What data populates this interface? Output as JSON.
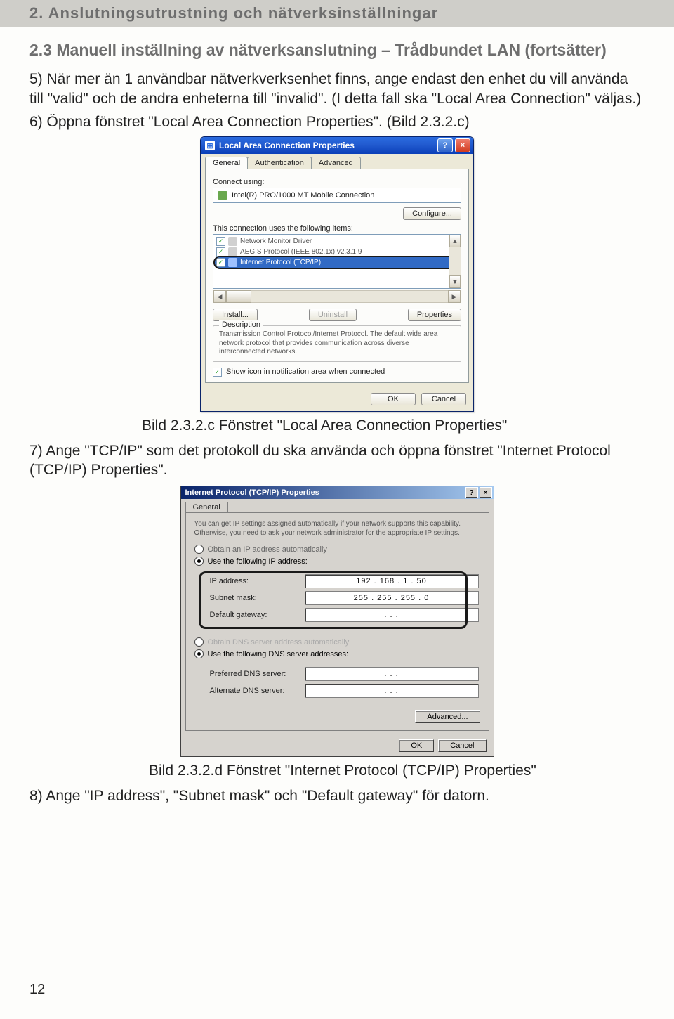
{
  "header": {
    "chapter_title": "2. Anslutningsutrustning och nätverksinställningar"
  },
  "section": {
    "title": "2.3 Manuell inställning av nätverksanslutning – Trådbundet LAN (fortsätter)"
  },
  "paragraphs": {
    "p5": "5) När mer än 1 användbar nätverkverksenhet finns, ange endast den enhet du vill använda till \"valid\" och de andra enheterna till \"invalid\". (I detta fall ska \"Local Area Connection\" väljas.)",
    "p6": "6) Öppna fönstret \"Local Area Connection Properties\". (Bild 2.3.2.c)",
    "cap1": "Bild 2.3.2.c Fönstret \"Local Area Connection Properties\"",
    "p7": "7) Ange \"TCP/IP\" som det protokoll du ska använda och öppna fönstret \"Internet Protocol (TCP/IP) Properties\".",
    "cap2": "Bild 2.3.2.d Fönstret \"Internet Protocol (TCP/IP) Properties\"",
    "p8": "8) Ange \"IP address\", \"Subnet mask\" och \"Default gateway\" för datorn."
  },
  "page_number": "12",
  "dlg1": {
    "title": "Local Area Connection Properties",
    "help": "?",
    "close": "×",
    "tabs": {
      "general": "General",
      "auth": "Authentication",
      "adv": "Advanced"
    },
    "connect_using_label": "Connect using:",
    "nic": "Intel(R) PRO/1000 MT Mobile Connection",
    "nic_icon": "⊞",
    "configure_btn": "Configure...",
    "items_label": "This connection uses the following items:",
    "items": {
      "nm": "Network Monitor Driver",
      "aegis": "AEGIS Protocol (IEEE 802.1x) v2.3.1.9",
      "tcpip": "Internet Protocol (TCP/IP)"
    },
    "install_btn": "Install...",
    "uninstall_btn": "Uninstall",
    "properties_btn": "Properties",
    "desc_legend": "Description",
    "desc_text": "Transmission Control Protocol/Internet Protocol. The default wide area network protocol that provides communication across diverse interconnected networks.",
    "show_icon": "Show icon in notification area when connected",
    "ok_btn": "OK",
    "cancel_btn": "Cancel",
    "scroll_up": "▲",
    "scroll_down": "▼",
    "scroll_left": "◀",
    "scroll_right": "▶",
    "check": "✓"
  },
  "dlg2": {
    "title": "Internet Protocol (TCP/IP) Properties",
    "help": "?",
    "close": "×",
    "tab_general": "General",
    "intro": "You can get IP settings assigned automatically if your network supports this capability. Otherwise, you need to ask your network administrator for the appropriate IP settings.",
    "r_obtain_ip": "Obtain an IP address automatically",
    "r_use_ip": "Use the following IP address:",
    "ip_label": "IP address:",
    "ip_value": "192 . 168 .  1  .  50",
    "mask_label": "Subnet mask:",
    "mask_value": "255 . 255 . 255 .  0",
    "gw_label": "Default gateway:",
    "gw_value": ".        .        .",
    "r_obtain_dns": "Obtain DNS server address automatically",
    "r_use_dns": "Use the following DNS server addresses:",
    "pref_dns_label": "Preferred DNS server:",
    "alt_dns_label": "Alternate DNS server:",
    "dns_blank": ".        .        .",
    "advanced_btn": "Advanced...",
    "ok_btn": "OK",
    "cancel_btn": "Cancel"
  }
}
